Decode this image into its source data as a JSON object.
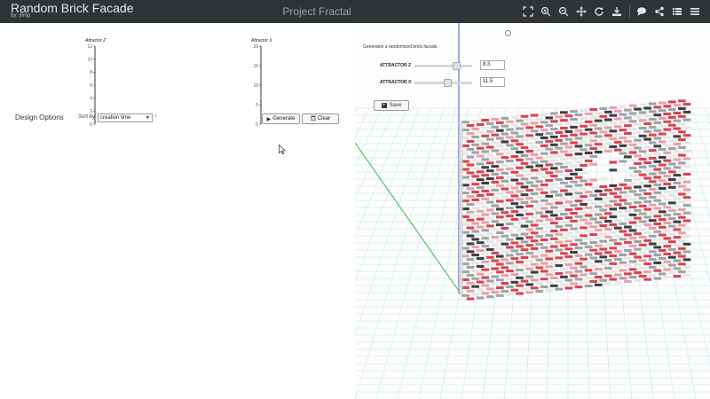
{
  "app": {
    "title": "Random Brick Facade",
    "author": "by: jlfmp",
    "project": "Project Fractal"
  },
  "toolbar": {
    "icons": [
      "fullscreen-icon",
      "zoom-in-icon",
      "zoom-out-icon",
      "pan-icon",
      "rotate-icon",
      "download-icon",
      "comment-icon",
      "share-icon",
      "list-icon",
      "menu-icon"
    ]
  },
  "results": {
    "chart_data": [
      {
        "type": "axis",
        "title": "Attractor Z",
        "ticks": [
          "12",
          "10",
          "8",
          "6",
          "4",
          "2",
          "0"
        ],
        "ylim": [
          0,
          12
        ]
      },
      {
        "type": "axis",
        "title": "Attractor X",
        "ticks": [
          "20",
          "15",
          "10",
          "5",
          "0"
        ],
        "ylim": [
          0,
          20
        ]
      }
    ],
    "design_options_label": "Design Options",
    "sort_by_label": "Sort by",
    "sort_value": "creation time",
    "sort_dir": "↑",
    "generate_label": "Generate",
    "clear_label": "Clear"
  },
  "params": {
    "description": "Generates a randomized brick facade.",
    "sliders": [
      {
        "label": "ATTRACTOR Z",
        "value": "8.3",
        "fraction": 0.72
      },
      {
        "label": "ATTRACTOR X",
        "value": "11.5",
        "fraction": 0.58
      }
    ],
    "save_label": "Save"
  },
  "colors": {
    "topbar": "#2f3436",
    "brick_red": "#d9434f",
    "brick_pink": "#e9a0a6",
    "brick_dark": "#3b3f43",
    "brick_gray": "#9ea3a6",
    "brick_light": "#e6e6e6",
    "grid": "#bfe1ea"
  }
}
